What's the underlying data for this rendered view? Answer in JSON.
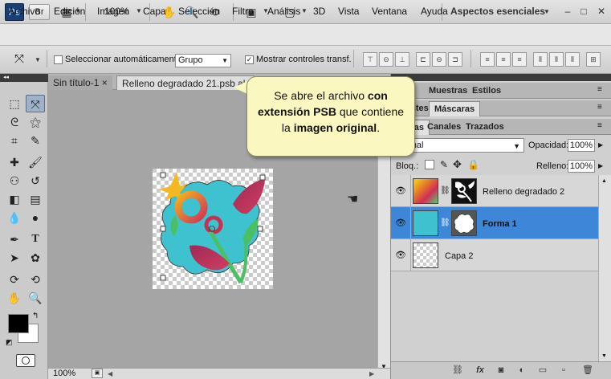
{
  "app": {
    "logo": "Ps",
    "bridge_label": "Br",
    "zoom": "100%",
    "workspace": "Aspectos esenciales",
    "workspace_arrow": "▼",
    "window_controls": [
      "–",
      "□",
      "✕"
    ]
  },
  "menu": [
    "Archivo",
    "Edición",
    "Imagen",
    "Capa",
    "Selección",
    "Filtro",
    "Análisis",
    "3D",
    "Vista",
    "Ventana",
    "Ayuda"
  ],
  "options": {
    "auto_select_label": "Seleccionar automáticamente:",
    "auto_select_value": "Grupo",
    "show_transform_label": "Mostrar controles transf.",
    "show_transform_checked": true
  },
  "tabs": [
    {
      "label": "Sin título-1",
      "close": "×"
    },
    {
      "label": "Relleno degradado 21.psb al 1"
    }
  ],
  "status": {
    "zoom": "100%"
  },
  "panels": {
    "top_tabs": [
      "Muestras",
      "Estilos"
    ],
    "mid_tabs": [
      "Ajustes",
      "Máscaras"
    ],
    "layer_tabs": [
      "Capas",
      "Canales",
      "Trazados"
    ],
    "blend_mode": "Normal",
    "opacity_label": "Opacidad:",
    "opacity_value": "100%",
    "lock_label": "Bloq.:",
    "fill_label": "Relleno:",
    "fill_value": "100%"
  },
  "layers": [
    {
      "name": "Relleno degradado 2",
      "selected": false
    },
    {
      "name": "Forma 1",
      "selected": true
    },
    {
      "name": "Capa 2",
      "selected": false
    }
  ],
  "callout": {
    "t1": "Se abre el archivo ",
    "b1": "con extensión PSB",
    "t2": " que contiene la ",
    "b2": "imagen original",
    "t3": "."
  },
  "colors": {
    "selection": "#3e87d8",
    "shape_fill": "#3fc2cf",
    "callout_bg": "#fbf7c0"
  }
}
